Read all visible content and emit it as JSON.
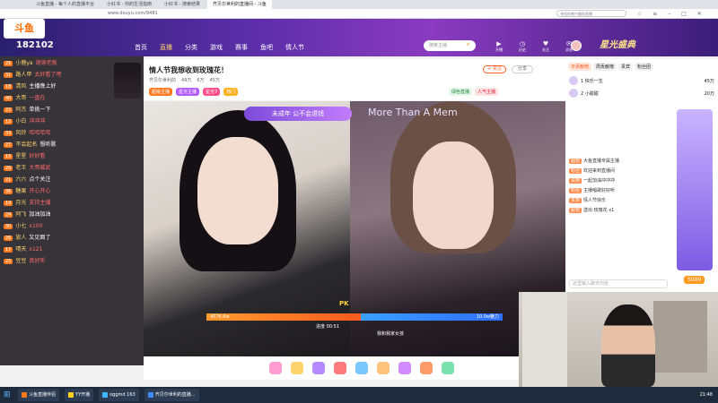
{
  "browser": {
    "tabs": [
      {
        "label": "斗鱼直播 - 每个人的直播平台"
      },
      {
        "label": "小红书 - 你的生活指南"
      },
      {
        "label": "小红书 - 搜索结果"
      },
      {
        "label": "齐贝尔世利的直播间 - 斗鱼"
      }
    ],
    "url": "www.douyu.com/9481",
    "search_placeholder": "寻找你感兴趣的直播",
    "icons": [
      "star-icon",
      "menu-icon",
      "minimize-icon",
      "maximize-icon",
      "close-icon"
    ]
  },
  "site": {
    "logo": "斗鱼",
    "viewer_count": "182102",
    "nav": [
      "首页",
      "直播",
      "分类",
      "游戏",
      "赛事",
      "鱼吧",
      "情人节"
    ],
    "active_nav": "直播",
    "search_placeholder": "搜索主播",
    "header_icons": [
      "开播",
      "历史",
      "关注",
      "消息"
    ],
    "banner": "星光盛典"
  },
  "room": {
    "title": "情人节我想收到玫瑰花！",
    "meta": [
      "齐贝尔世利的",
      "49万",
      "6万",
      "45万"
    ],
    "badges": [
      "超级主播",
      "星光主播",
      "星光7",
      "热门"
    ],
    "follow_label": "+ 关注",
    "share_label": "分享",
    "right_tags": [
      "绿色直播",
      "人气主播"
    ]
  },
  "video": {
    "pk_banner": "未成年 公不会退钱",
    "lyric": "More Than A Mem",
    "pk_left": "4076.6w",
    "pk_right": "10.0w魅力",
    "pk_vs": "PK",
    "pk_timer": "进度 00:51",
    "pk_label_r": "我和我家女孩"
  },
  "right_panel": {
    "tabs": [
      "日贡献榜",
      "周贡献榜",
      "贵宾",
      "粉丝团"
    ],
    "rank": [
      {
        "name": "1 快乐一生",
        "value": "45万"
      },
      {
        "name": "2 小甜甜",
        "value": "20万"
      }
    ],
    "chat": [
      {
        "tag": "超管",
        "text": "大鱼直播专属主播"
      },
      {
        "tag": "粉丝",
        "text": "欢迎来到直播间"
      },
      {
        "tag": "贵族",
        "text": "一起加油冲冲冲"
      },
      {
        "tag": "粉丝",
        "text": "主播唱歌好好听"
      },
      {
        "tag": "贵族",
        "text": "情人节快乐"
      },
      {
        "tag": "超管",
        "text": "送出 玫瑰花 x1"
      }
    ],
    "price": "5000",
    "input_placeholder": "这里输入聊天内容"
  },
  "overlay_chat": [
    {
      "lv": "25",
      "name": "小鹿ya",
      "text": "谢谢老板",
      "white": false
    },
    {
      "lv": "31",
      "name": "路人甲",
      "text": "太好看了吧",
      "white": false
    },
    {
      "lv": "18",
      "name": "清风",
      "text": "主播晚上好",
      "white": true
    },
    {
      "lv": "40",
      "name": "大哥",
      "text": "一直在",
      "white": false
    },
    {
      "lv": "22",
      "name": "阿杰",
      "text": "单挑一下",
      "white": true
    },
    {
      "lv": "12",
      "name": "小白",
      "text": "冲冲冲",
      "white": false
    },
    {
      "lv": "33",
      "name": "风铃",
      "text": "哈哈哈哈",
      "white": false
    },
    {
      "lv": "27",
      "name": "不会起名",
      "text": "想听歌",
      "white": true
    },
    {
      "lv": "15",
      "name": "星星",
      "text": "好好看",
      "white": false
    },
    {
      "lv": "29",
      "name": "老王",
      "text": "大哥威武",
      "white": false
    },
    {
      "lv": "21",
      "name": "六六",
      "text": "点个关注",
      "white": true
    },
    {
      "lv": "36",
      "name": "糖果",
      "text": "开心开心",
      "white": false
    },
    {
      "lv": "19",
      "name": "月光",
      "text": "支持主播",
      "white": false
    },
    {
      "lv": "24",
      "name": "阿飞",
      "text": "加油加油",
      "white": true
    },
    {
      "lv": "30",
      "name": "小七",
      "text": "x100",
      "white": false
    },
    {
      "lv": "26",
      "name": "旅人",
      "text": "又见面了",
      "white": true
    },
    {
      "lv": "17",
      "name": "晴天",
      "text": "x121",
      "white": false
    },
    {
      "lv": "23",
      "name": "豆豆",
      "text": "真好听",
      "white": false
    }
  ],
  "taskbar": {
    "tasks": [
      "斗鱼直播伴侣",
      "YY开播",
      "oggmd 163",
      "齐贝尔世利的直播..."
    ],
    "clock": "21:48"
  },
  "colors": {
    "brand": "#ff5d23",
    "header_purple": "#5b2ea8"
  }
}
